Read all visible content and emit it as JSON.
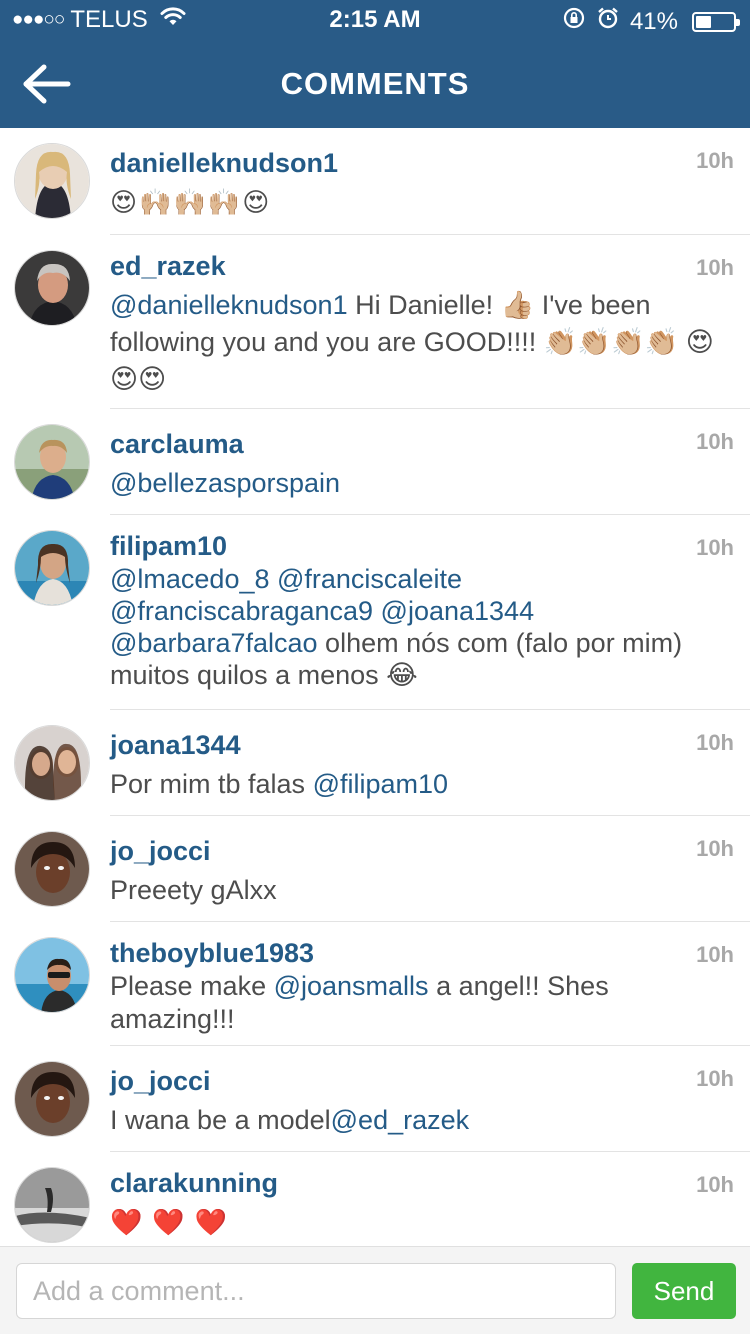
{
  "status_bar": {
    "signal": "●●●○○",
    "carrier": "TELUS",
    "time": "2:15 AM",
    "battery": "41%",
    "battery_level": 0.41
  },
  "header": {
    "title": "COMMENTS"
  },
  "comments": [
    {
      "username": "danielleknudson1",
      "time": "10h",
      "segments": [
        {
          "text": "😍🙌🏼🙌🏼🙌🏼😍",
          "kind": "emoji"
        }
      ]
    },
    {
      "username": "ed_razek",
      "time": "10h",
      "segments": [
        {
          "text": "@danielleknudson1",
          "kind": "mention"
        },
        {
          "text": " Hi Danielle! 👍🏼 I've been following you and you are GOOD!!!! 👏🏼👏🏼👏🏼👏🏼 😍😍😍",
          "kind": "text"
        }
      ]
    },
    {
      "username": "carclauma",
      "time": "10h",
      "segments": [
        {
          "text": "@bellezasporspain",
          "kind": "mention"
        }
      ]
    },
    {
      "username": "filipam10",
      "time": "10h",
      "segments": [
        {
          "text": "@lmacedo_8 @franciscaleite @franciscabraganca9 @joana1344 @barbara7falcao",
          "kind": "mention"
        },
        {
          "text": " olhem nós com (falo por mim) muitos quilos a menos 😂",
          "kind": "text"
        }
      ]
    },
    {
      "username": "joana1344",
      "time": "10h",
      "segments": [
        {
          "text": "Por mim tb falas ",
          "kind": "text"
        },
        {
          "text": "@filipam10",
          "kind": "mention"
        }
      ]
    },
    {
      "username": "jo_jocci",
      "time": "10h",
      "segments": [
        {
          "text": "Preeety gAlxx",
          "kind": "text"
        }
      ]
    },
    {
      "username": "theboyblue1983",
      "time": "10h",
      "segments": [
        {
          "text": "Please make ",
          "kind": "text"
        },
        {
          "text": "@joansmalls",
          "kind": "mention"
        },
        {
          "text": " a angel!! Shes amazing!!!",
          "kind": "text"
        }
      ]
    },
    {
      "username": "jo_jocci",
      "time": "10h",
      "segments": [
        {
          "text": "I wana be a model",
          "kind": "text"
        },
        {
          "text": "@ed_razek",
          "kind": "mention"
        }
      ]
    },
    {
      "username": "clarakunning",
      "time": "10h",
      "segments": [
        {
          "text": "❤️❤️❤️",
          "kind": "emoji"
        }
      ]
    }
  ],
  "comment_input": {
    "placeholder": "Add a comment...",
    "value": "",
    "send_label": "Send"
  },
  "colors": {
    "header_bg": "#295b87",
    "link": "#245b87",
    "send_button": "#41b53f"
  },
  "icons": {
    "back": "back-arrow-icon",
    "wifi": "wifi-icon",
    "rotation_lock": "rotation-lock-icon",
    "alarm": "alarm-icon",
    "battery": "battery-icon"
  }
}
